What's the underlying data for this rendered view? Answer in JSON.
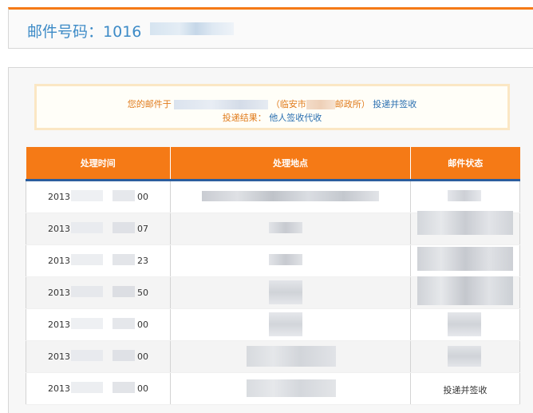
{
  "header": {
    "title_label": "邮件号码：",
    "number_prefix": "1016"
  },
  "notice": {
    "prefix": "您的邮件于",
    "location_open": "（临安市",
    "location_close": "邮政所）",
    "action": "投递并签收",
    "result_label": "投递结果：",
    "result_value": "他人签收代收"
  },
  "table": {
    "columns": [
      "处理时间",
      "处理地点",
      "邮件状态"
    ],
    "rows": [
      {
        "time_start": "2013",
        "time_end": "00",
        "status": ""
      },
      {
        "time_start": "2013",
        "time_end": "07",
        "status": ""
      },
      {
        "time_start": "2013",
        "time_end": "23",
        "status": ""
      },
      {
        "time_start": "2013",
        "time_end": "50",
        "status": ""
      },
      {
        "time_start": "2013",
        "time_end": "00",
        "status": ""
      },
      {
        "time_start": "2013",
        "time_end": "00",
        "status": ""
      },
      {
        "time_start": "2013",
        "time_end": "00",
        "status": "投递并签收"
      }
    ]
  }
}
